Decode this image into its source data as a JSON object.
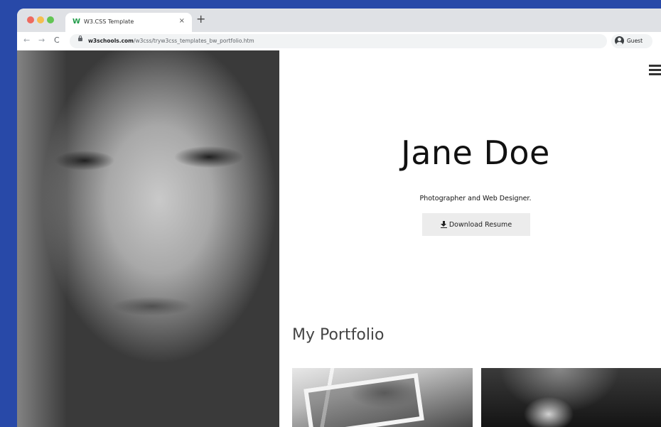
{
  "browser": {
    "tab": {
      "favicon": "W",
      "title": "W3.CSS Template",
      "close_glyph": "×"
    },
    "new_tab_glyph": "+",
    "nav": {
      "back_glyph": "←",
      "forward_glyph": "→",
      "reload_glyph": "C"
    },
    "address": {
      "host": "w3schools.com",
      "path": "/w3css/tryw3css_templates_bw_portfolio.htm"
    },
    "profile_label": "Guest"
  },
  "page": {
    "hero": {
      "name": "Jane Doe",
      "tagline": "Photographer and Web Designer.",
      "resume_button": "Download Resume"
    },
    "portfolio": {
      "title": "My Portfolio"
    }
  },
  "colors": {
    "desktop_background": "#2849a8",
    "traffic_red": "#ee6a5f",
    "traffic_yellow": "#f5be4f",
    "traffic_green": "#62c554",
    "button_background": "#ececec",
    "favicon_green": "#1f9b48"
  },
  "icons": {
    "menu": "hamburger-icon",
    "download": "download-icon",
    "profile": "profile-icon",
    "lock": "lock-icon"
  }
}
